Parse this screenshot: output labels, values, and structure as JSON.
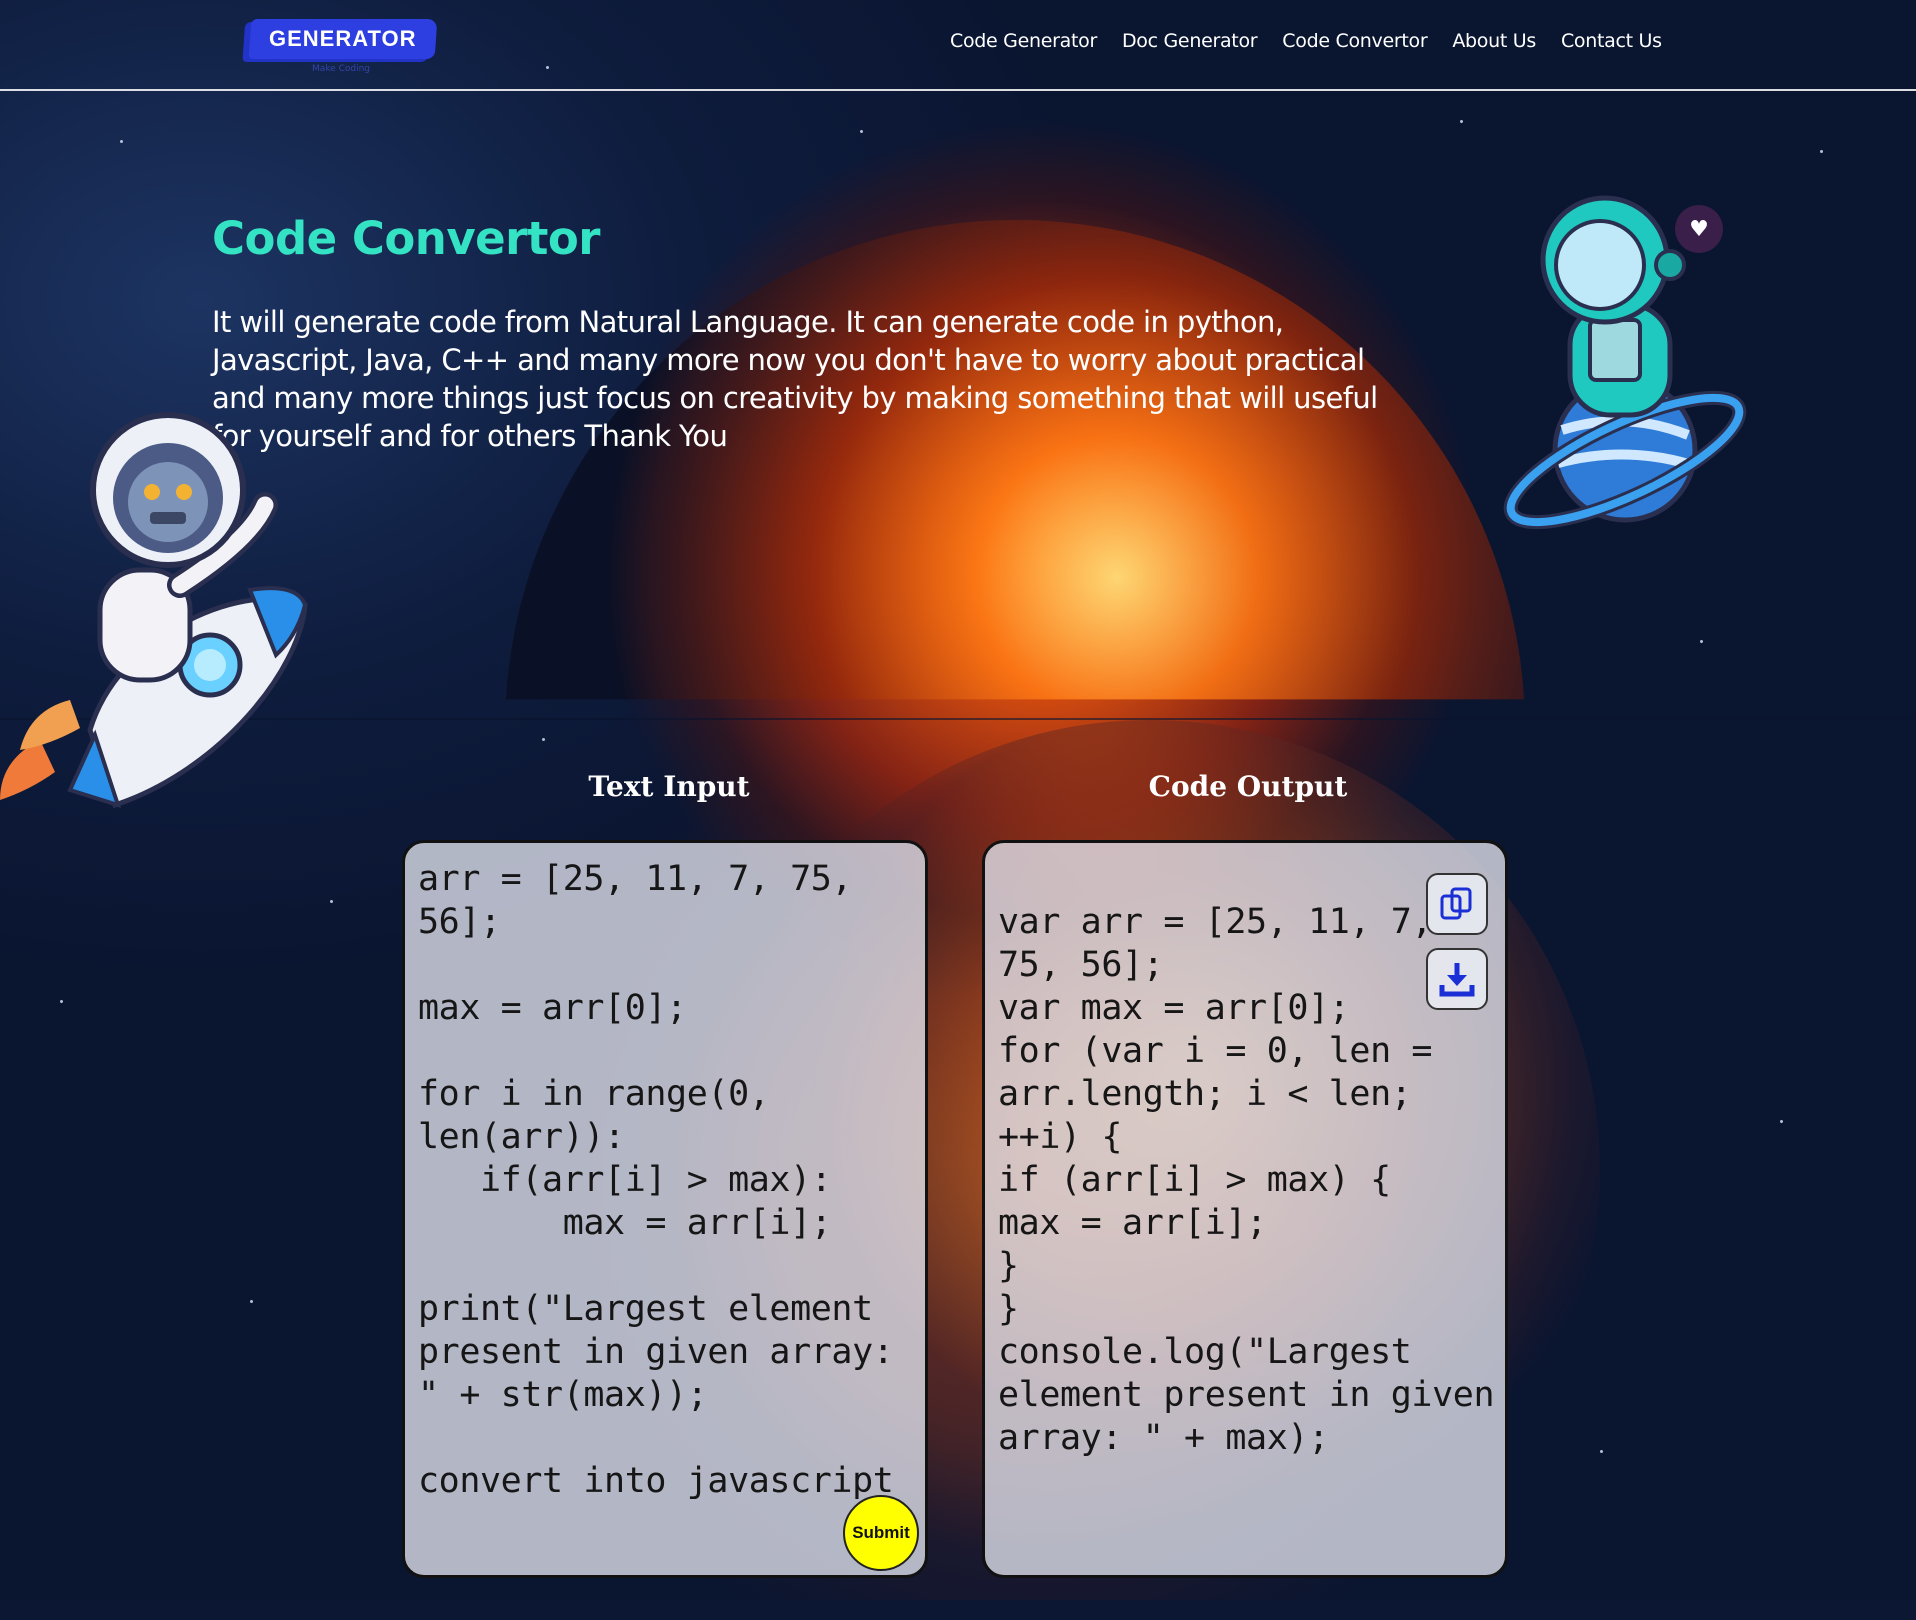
{
  "brand": {
    "logo_text": "GENERATOR",
    "tagline": "Make Coding"
  },
  "nav": {
    "items": [
      {
        "label": "Code Generator"
      },
      {
        "label": "Doc Generator"
      },
      {
        "label": "Code Convertor"
      },
      {
        "label": "About Us"
      },
      {
        "label": "Contact Us"
      }
    ]
  },
  "hero": {
    "title": "Code Convertor",
    "description": "It will generate code from Natural Language. It can generate code in python, Javascript, Java, C++ and many more now you don't have to worry about practical and many more things just focus on creativity by making something that will useful for yourself and for others Thank You"
  },
  "input_panel": {
    "heading": "Text Input",
    "text": "arr = [25, 11, 7, 75, 56];\n\nmax = arr[0];\n\nfor i in range(0, len(arr)):\n   if(arr[i] > max):\n       max = arr[i];\n\nprint(\"Largest element present in given array: \" + str(max));\n\nconvert into javascript",
    "submit_label": "Submit"
  },
  "output_panel": {
    "heading": "Code Output",
    "text": "var arr = [25, 11, 7, 75, 56];\nvar max = arr[0];\nfor (var i = 0, len = arr.length; i < len; ++i) {\nif (arr[i] > max) {\nmax = arr[i];\n}\n}\nconsole.log(\"Largest element present in given array: \" + max);",
    "copy_icon": "copy-icon",
    "download_icon": "download-icon"
  },
  "decor": {
    "heart_icon": "heart-icon"
  },
  "colors": {
    "title_accent": "#34e3c4",
    "logo_bg": "#2d3fe0",
    "submit_bg": "#ffff00",
    "icon_blue": "#1a2fd6"
  }
}
